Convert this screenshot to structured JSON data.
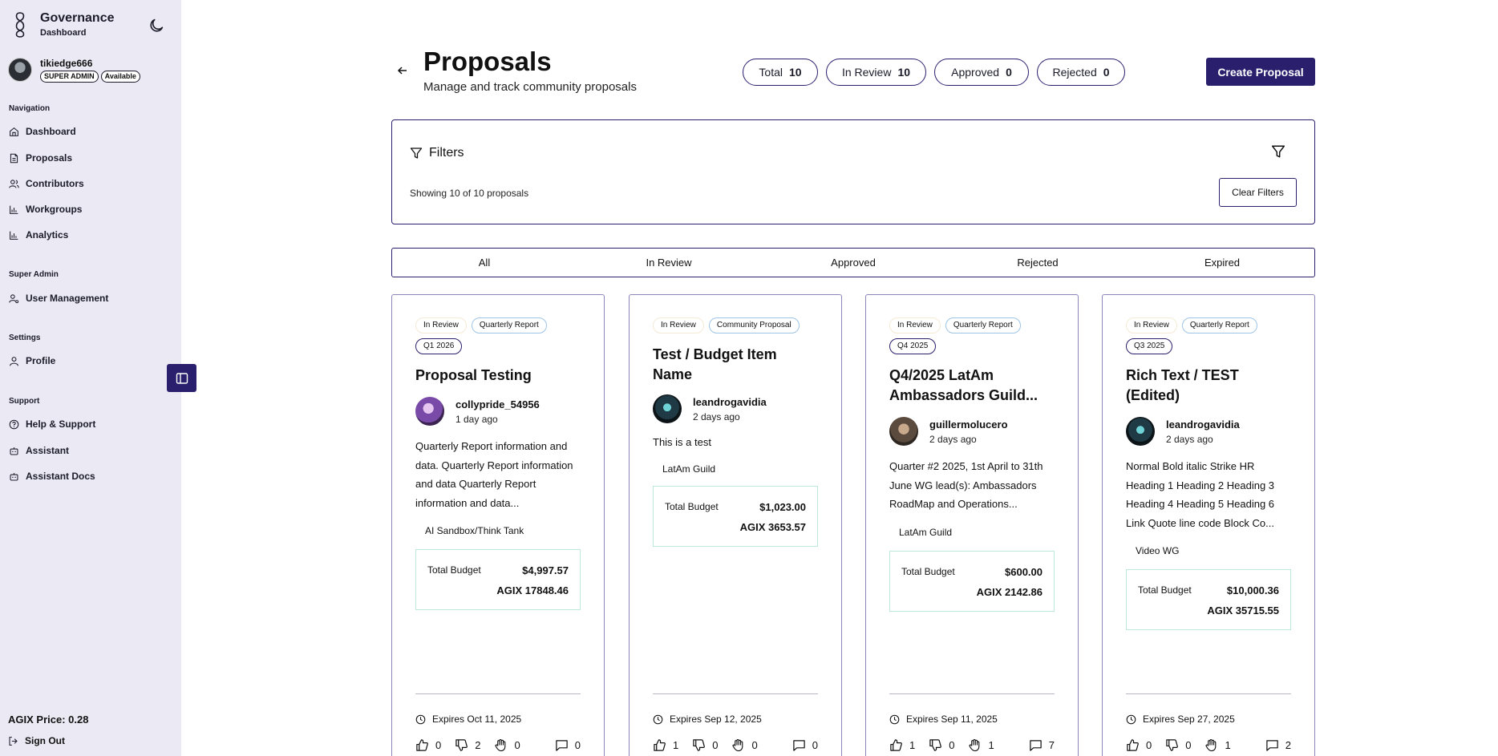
{
  "brand": {
    "title": "Governance",
    "subtitle": "Dashboard"
  },
  "user": {
    "name": "tikiedge666",
    "role": "SUPER ADMIN",
    "status": "Available"
  },
  "nav": {
    "navigation_label": "Navigation",
    "dashboard": "Dashboard",
    "proposals": "Proposals",
    "contributors": "Contributors",
    "workgroups": "Workgroups",
    "analytics": "Analytics",
    "super_admin_label": "Super Admin",
    "user_management": "User Management",
    "settings_label": "Settings",
    "profile": "Profile",
    "support_label": "Support",
    "help_support": "Help & Support",
    "assistant": "Assistant",
    "assistant_docs": "Assistant Docs"
  },
  "footer": {
    "agix_price": "AGIX Price: 0.28",
    "sign_out": "Sign Out"
  },
  "header": {
    "title": "Proposals",
    "subtitle": "Manage and track community proposals",
    "create_label": "Create Proposal"
  },
  "stats": {
    "total_label": "Total",
    "total_value": "10",
    "review_label": "In Review",
    "review_value": "10",
    "approved_label": "Approved",
    "approved_value": "0",
    "rejected_label": "Rejected",
    "rejected_value": "0"
  },
  "filters": {
    "title": "Filters",
    "showing": "Showing 10 of 10 proposals",
    "clear_label": "Clear Filters"
  },
  "tabs": [
    "All",
    "In Review",
    "Approved",
    "Rejected",
    "Expired"
  ],
  "cards": [
    {
      "status": "In Review",
      "type": "Quarterly Report",
      "quarter": "Q1 2026",
      "title": "Proposal Testing",
      "author": "collypride_54956",
      "time": "1 day ago",
      "description": "Quarterly Report information and data. Quarterly Report information and data Quarterly Report information and data...",
      "group": "AI Sandbox/Think Tank",
      "budget_label": "Total Budget",
      "budget_usd": "$4,997.57",
      "budget_agix": "AGIX 17848.46",
      "expires": "Expires Oct 11, 2025",
      "likes": "0",
      "dislikes": "2",
      "abstain": "0",
      "comments": "0"
    },
    {
      "status": "In Review",
      "type": "Community Proposal",
      "quarter": "",
      "title": "Test / Budget Item Name",
      "author": "leandrogavidia",
      "time": "2 days ago",
      "description": "This is a test",
      "group": "LatAm Guild",
      "budget_label": "Total Budget",
      "budget_usd": "$1,023.00",
      "budget_agix": "AGIX 3653.57",
      "expires": "Expires Sep 12, 2025",
      "likes": "1",
      "dislikes": "0",
      "abstain": "0",
      "comments": "0"
    },
    {
      "status": "In Review",
      "type": "Quarterly Report",
      "quarter": "Q4 2025",
      "title": "Q4/2025 LatAm Ambassadors Guild...",
      "author": "guillermolucero",
      "time": "2 days ago",
      "description": "Quarter #2 2025, 1st April to 31th June WG lead(s): Ambassadors RoadMap and Operations...",
      "group": "LatAm Guild",
      "budget_label": "Total Budget",
      "budget_usd": "$600.00",
      "budget_agix": "AGIX 2142.86",
      "expires": "Expires Sep 11, 2025",
      "likes": "1",
      "dislikes": "0",
      "abstain": "1",
      "comments": "7"
    },
    {
      "status": "In Review",
      "type": "Quarterly Report",
      "quarter": "Q3 2025",
      "title": "Rich Text / TEST (Edited)",
      "author": "leandrogavidia",
      "time": "2 days ago",
      "description": "Normal Bold italic Strike HR Heading 1 Heading 2 Heading 3 Heading 4 Heading 5 Heading 6 Link Quote line code Block Co...",
      "group": "Video WG",
      "budget_label": "Total Budget",
      "budget_usd": "$10,000.36",
      "budget_agix": "AGIX 35715.55",
      "expires": "Expires Sep 27, 2025",
      "likes": "0",
      "dislikes": "0",
      "abstain": "1",
      "comments": "2"
    }
  ],
  "colors": {
    "accent": "#2a1f6d",
    "sidebar_bg": "#ebe9f3"
  }
}
